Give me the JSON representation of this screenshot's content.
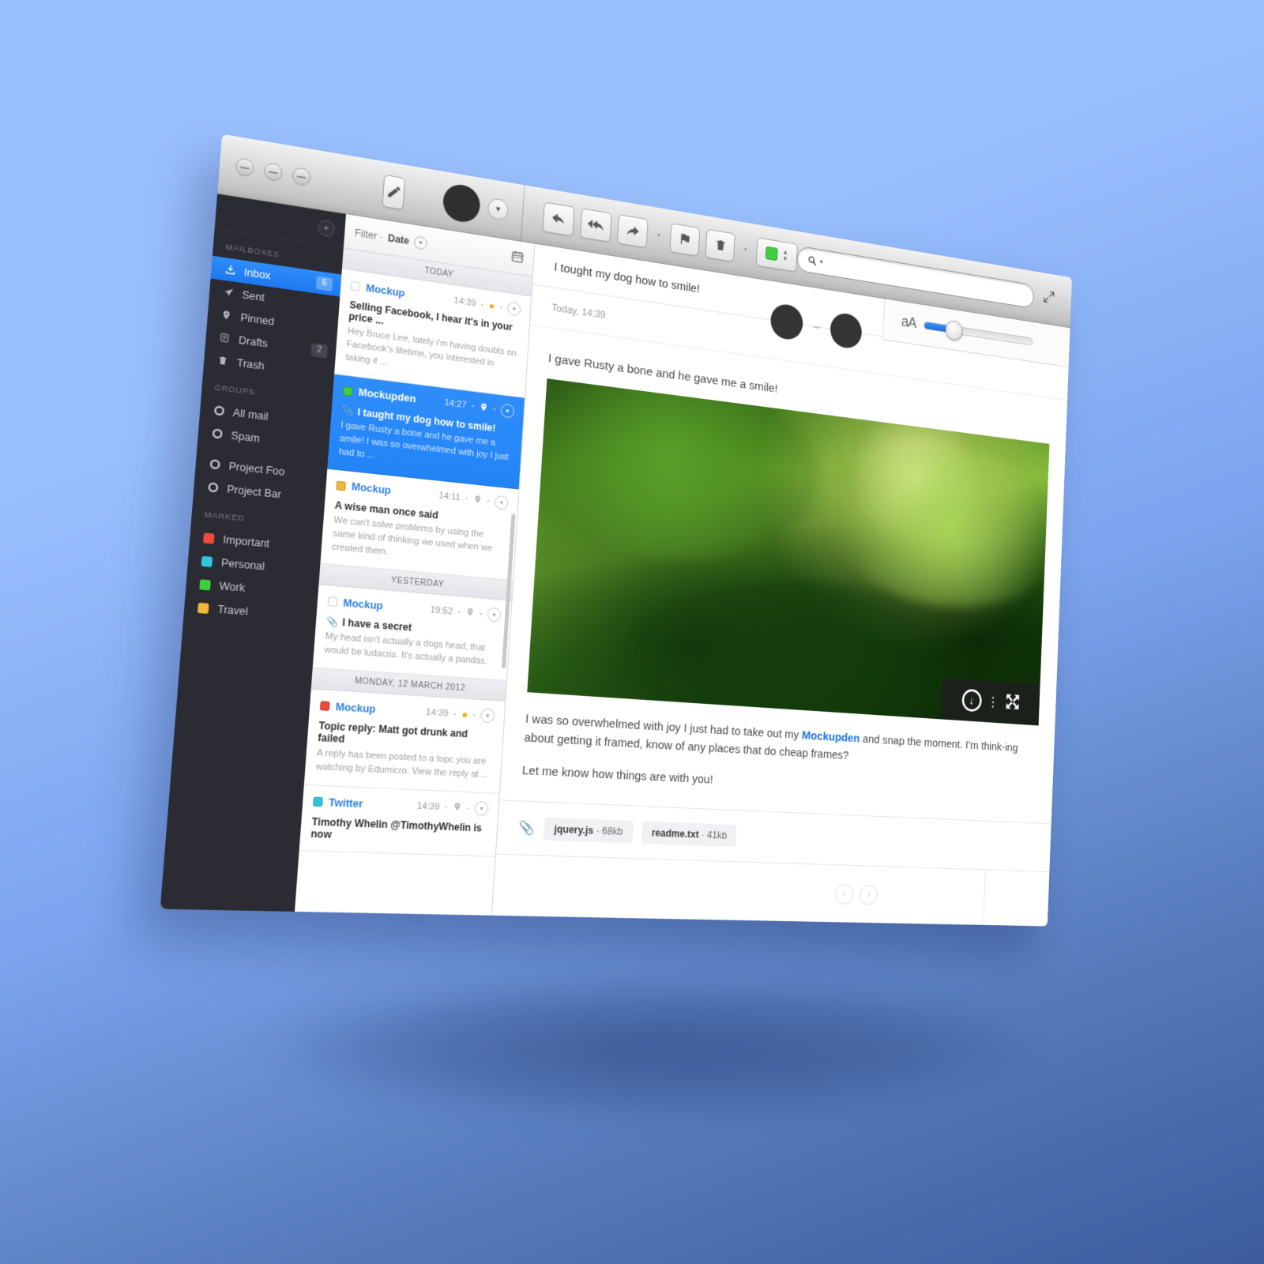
{
  "window": {
    "traffic_lights": [
      "close",
      "minimize",
      "zoom"
    ],
    "compose_icon": "pencil-icon",
    "account_chevron": "chevron-down-icon",
    "search": {
      "placeholder": "",
      "value": "",
      "icon": "search-icon"
    },
    "resize_icon": "resize-expand-icon",
    "toolbar": [
      {
        "name": "reply",
        "icon": "reply-arrow-icon"
      },
      {
        "name": "reply-all",
        "icon": "reply-all-arrow-icon"
      },
      {
        "name": "forward",
        "icon": "forward-arrow-icon"
      },
      {
        "name": "flag",
        "icon": "flag-icon"
      },
      {
        "name": "delete",
        "icon": "trash-icon"
      }
    ],
    "label_picker": {
      "color": "#3fd03f",
      "stepper_up": "▲",
      "stepper_down": "▼"
    },
    "font_size": {
      "label": "aA",
      "value": 25
    }
  },
  "sidebar": {
    "add_button": "add-mailbox-icon",
    "sections": [
      {
        "title": "MAILBOXES",
        "items": [
          {
            "label": "Inbox",
            "icon": "inbox-icon",
            "badge": "6",
            "active": true
          },
          {
            "label": "Sent",
            "icon": "send-icon",
            "badge": "",
            "active": false
          },
          {
            "label": "Pinned",
            "icon": "pin-icon",
            "badge": "",
            "active": false
          },
          {
            "label": "Drafts",
            "icon": "drafts-icon",
            "badge": "2",
            "active": false
          },
          {
            "label": "Trash",
            "icon": "trash-icon",
            "badge": "",
            "active": false
          }
        ]
      },
      {
        "title": "GROUPS",
        "items": [
          {
            "label": "All mail",
            "icon": "ring-icon",
            "badge": "",
            "active": false
          },
          {
            "label": "Spam",
            "icon": "ring-icon",
            "badge": "",
            "active": false
          },
          {
            "label": "Project Foo",
            "icon": "ring-icon",
            "badge": "",
            "active": false
          },
          {
            "label": "Project Bar",
            "icon": "ring-icon",
            "badge": "",
            "active": false
          }
        ]
      },
      {
        "title": "MARKED",
        "items": [
          {
            "label": "Important",
            "icon": "swatch-icon",
            "color": "#ef4a3c",
            "badge": "",
            "active": false
          },
          {
            "label": "Personal",
            "icon": "swatch-icon",
            "color": "#30c6e0",
            "badge": "",
            "active": false
          },
          {
            "label": "Work",
            "icon": "swatch-icon",
            "color": "#3fd03f",
            "badge": "",
            "active": false
          },
          {
            "label": "Travel",
            "icon": "swatch-icon",
            "color": "#f2b73d",
            "badge": "",
            "active": false
          }
        ]
      }
    ]
  },
  "list": {
    "filter_prefix": "Filter ·",
    "filter_value": "Date",
    "filter_chevron": "chevron-down-icon",
    "calendar_icon": "calendar-icon",
    "groups": [
      {
        "day": "TODAY",
        "messages": [
          {
            "sender": "Mockup",
            "time": "14:39",
            "swatch": "#ffffff",
            "pinned": true,
            "attachment": false,
            "subject": "Selling Facebook, I hear it's in your price ...",
            "preview": "Hey Bruce Lee, lately i'm having doubts on Facebook's lifetime, you interested in taking it ...",
            "selected": false
          },
          {
            "sender": "Mockupden",
            "time": "14:27",
            "swatch": "#3fd03f",
            "pinned": false,
            "attachment": true,
            "subject": "I taught my dog how to smile!",
            "preview": "I gave Rusty a bone and he gave me a smile! I was so overwhelmed with joy I just had to ...",
            "selected": true
          },
          {
            "sender": "Mockup",
            "time": "14:11",
            "swatch": "#f2b73d",
            "pinned": false,
            "attachment": false,
            "subject": "A wise man once said",
            "preview": "We can't solve problems by using the same kind of thinking we used when we created them.",
            "selected": false
          }
        ]
      },
      {
        "day": "YESTERDAY",
        "messages": [
          {
            "sender": "Mockup",
            "time": "19:52",
            "swatch": "#ffffff",
            "pinned": false,
            "attachment": true,
            "subject": "I have a secret",
            "preview": "My head isn't actually a dogs head, that would be ludacris. It's actually a pandas.",
            "selected": false
          }
        ]
      },
      {
        "day": "MONDAY, 12 MARCH 2012",
        "messages": [
          {
            "sender": "Mockup",
            "time": "14:39",
            "swatch": "#ef4a3c",
            "pinned": true,
            "attachment": false,
            "subject": "Topic reply: Matt got drunk and failed",
            "preview": "A reply has been posted to a topc you are watching by Edumicro. View the reply at ...",
            "selected": false
          },
          {
            "sender": "Twitter",
            "time": "14:39",
            "swatch": "#30c6e0",
            "pinned": false,
            "attachment": false,
            "subject": "Timothy Whelin @TimothyWhelin is now",
            "preview": "",
            "selected": false
          }
        ]
      }
    ]
  },
  "reader": {
    "subject": "I tought my dog how to smile!",
    "pin_icon": "pin-icon",
    "info_icon": "info-icon",
    "date": "Today, 14:39",
    "avatar_from": "sender-avatar",
    "avatar_arrow": "→",
    "avatar_to": "recipient-avatar",
    "lead": "I gave Rusty a bone and he gave me a smile!",
    "image_alt": "forest-canopy-photo",
    "image_download_icon": "download-icon",
    "image_expand_icon": "expand-fullscreen-icon",
    "body_part1": "I was so overwhelmed with joy I just had to take out my ",
    "body_link": "Mockupden",
    "body_part2": " and snap the moment. I’m think-ing about getting it framed, know of any places that do cheap frames?",
    "body_tail": "Let me know how things are with you!",
    "attachments_icon": "paperclip-icon",
    "attachments": [
      {
        "name": "jquery.js",
        "size": "68kb"
      },
      {
        "name": "readme.txt",
        "size": "41kb"
      }
    ],
    "prev_label": "‹",
    "next_label": "›"
  },
  "colors": {
    "accent_blue": "#2f8dfa",
    "link_blue": "#1a74e2",
    "sidebar_bg": "#2b2b33",
    "bg_top": "#9bc0fe",
    "bg_bottom": "#3c5c9e"
  }
}
